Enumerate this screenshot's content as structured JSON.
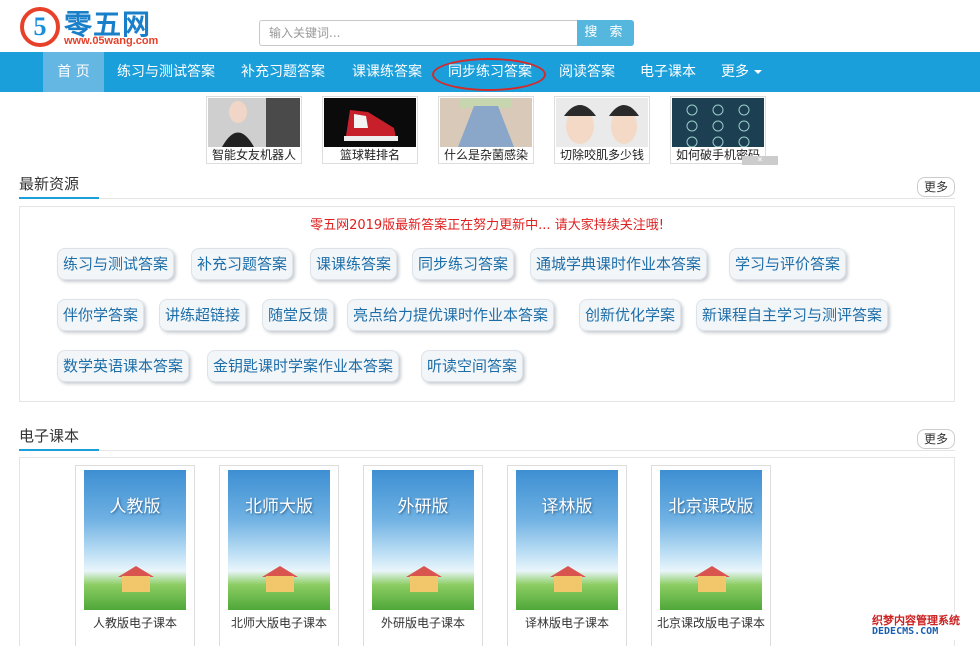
{
  "header": {
    "logo_text": "零五网",
    "logo_digit": "5",
    "logo_url": "www.05wang.com",
    "search_placeholder": "输入关键词...",
    "search_button": "搜 索"
  },
  "nav": {
    "items": [
      {
        "label": "首 页",
        "active": true
      },
      {
        "label": "练习与测试答案"
      },
      {
        "label": "补充习题答案"
      },
      {
        "label": "课课练答案"
      },
      {
        "label": "同步练习答案"
      },
      {
        "label": "阅读答案"
      },
      {
        "label": "电子课本"
      },
      {
        "label": "更多"
      }
    ]
  },
  "ads": {
    "items": [
      {
        "label": "智能女友机器人"
      },
      {
        "label": "篮球鞋排名"
      },
      {
        "label": "什么是杂菌感染"
      },
      {
        "label": "切除咬肌多少钱"
      },
      {
        "label": "如何破手机密码"
      }
    ]
  },
  "latest": {
    "title": "最新资源",
    "more": "更多",
    "notice": "零五网2019版最新答案正在努力更新中... 请大家持续关注哦!",
    "tags": [
      "练习与测试答案",
      "补充习题答案",
      "课课练答案",
      "同步练习答案",
      "通城学典课时作业本答案",
      "学习与评价答案",
      "伴你学答案",
      "讲练超链接",
      "随堂反馈",
      "亮点给力提优课时作业本答案",
      "创新优化学案",
      "新课程自主学习与测评答案",
      "数学英语课本答案",
      "金钥匙课时学案作业本答案",
      "听读空间答案"
    ]
  },
  "textbooks": {
    "title": "电子课本",
    "more": "更多",
    "books": [
      {
        "cover": "人教版",
        "label": "人教版电子课本"
      },
      {
        "cover": "北师大版",
        "label": "北师大版电子课本"
      },
      {
        "cover": "外研版",
        "label": "外研版电子课本"
      },
      {
        "cover": "译林版",
        "label": "译林版电子课本"
      },
      {
        "cover": "北京课改版",
        "label": "北京课改版电子课本"
      }
    ]
  },
  "watermark": {
    "line1": "织梦内容管理系统",
    "line2": "DEDECMS.COM"
  }
}
